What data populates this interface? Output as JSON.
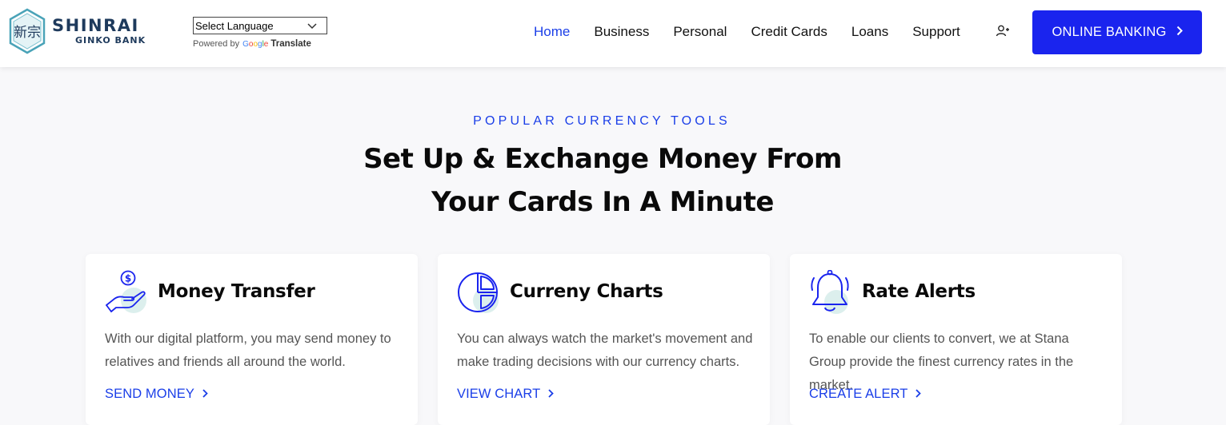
{
  "brand": {
    "name": "SHINRAI",
    "sub": "GINKO BANK",
    "emblem": "新宗",
    "colors": {
      "navy": "#1e3a5c",
      "accent": "#1a3ee8",
      "button": "#1a24ee"
    }
  },
  "translate": {
    "select_label": "Select Language",
    "powered_by": "Powered by",
    "google": "Google",
    "translate_word": "Translate"
  },
  "nav": {
    "items": [
      {
        "label": "Home",
        "active": true
      },
      {
        "label": "Business"
      },
      {
        "label": "Personal"
      },
      {
        "label": "Credit Cards"
      },
      {
        "label": "Loans"
      },
      {
        "label": "Support"
      }
    ],
    "user_icon": "user-plus-icon",
    "cta_label": "ONLINE BANKING"
  },
  "hero": {
    "eyebrow": "POPULAR CURRENCY TOOLS",
    "headline_line1": "Set Up & Exchange Money From",
    "headline_line2": "Your Cards In A Minute"
  },
  "cards": [
    {
      "icon": "hand-coin-icon",
      "title": "Money Transfer",
      "desc": "With our digital platform, you may send money to relatives and friends all around the world.",
      "link": "SEND MONEY"
    },
    {
      "icon": "pie-chart-icon",
      "title": "Curreny Charts",
      "desc": "You can always watch the market's movement and make trading decisions with our currency charts.",
      "link": "VIEW CHART"
    },
    {
      "icon": "bell-icon",
      "title": "Rate Alerts",
      "desc": "To enable our clients to convert, we at Stana Group provide the finest currency rates in the market.",
      "link": "CREATE ALERT"
    }
  ]
}
